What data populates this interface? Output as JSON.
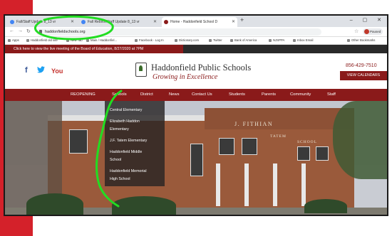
{
  "browser": {
    "tabs": [
      {
        "label": "Fall/Staff Update 8_13 vr"
      },
      {
        "label": "Fall Rebirth/Staff Update 8_13 vr"
      },
      {
        "label": "Home - Haddonfield School D"
      }
    ],
    "new_tab": "+",
    "window_controls": "– ▢ ✕",
    "url": "haddonfieldschools.org",
    "profile_label": "Paused",
    "bookmarks": [
      "Apps",
      "Haddonfield old site",
      "New Tab",
      "Main / Haddonfiel...",
      "Facebook - Log In",
      "Dictionary.com",
      "Twitter",
      "Bank of America",
      "NJSPPA",
      "Inbox Email",
      "Other Bookmarks"
    ]
  },
  "notice": {
    "link_text": "Click here to view the live meeting of the Board of Education, 8/27/2020 at 7PM"
  },
  "header": {
    "school_name": "Haddonfield Public Schools",
    "tagline": "Growing in Excellence",
    "phone": "856-429-7510",
    "calendar_button": "VIEW CALENDARS",
    "social": {
      "facebook": "f",
      "youtube": "You"
    }
  },
  "nav": {
    "items": [
      "REOPENING",
      "Schools",
      "District",
      "News",
      "Contact Us",
      "Students",
      "Parents",
      "Community",
      "Staff"
    ]
  },
  "dropdown": {
    "items": [
      "Central Elementary",
      "Elizabeth Haddon",
      "Elementary",
      "J.F. Tatem Elementary",
      "Haddonfield Middle",
      "School",
      "Haddonfield Memorial",
      "High School"
    ]
  },
  "hero": {
    "sign_main": "J. FITHIAN",
    "sign_2": "TATEM",
    "sign_3": "SCHOOL"
  },
  "colors": {
    "brand": "#8a1a1a",
    "left_band": "#d4212a",
    "annotation": "#22dd22"
  }
}
